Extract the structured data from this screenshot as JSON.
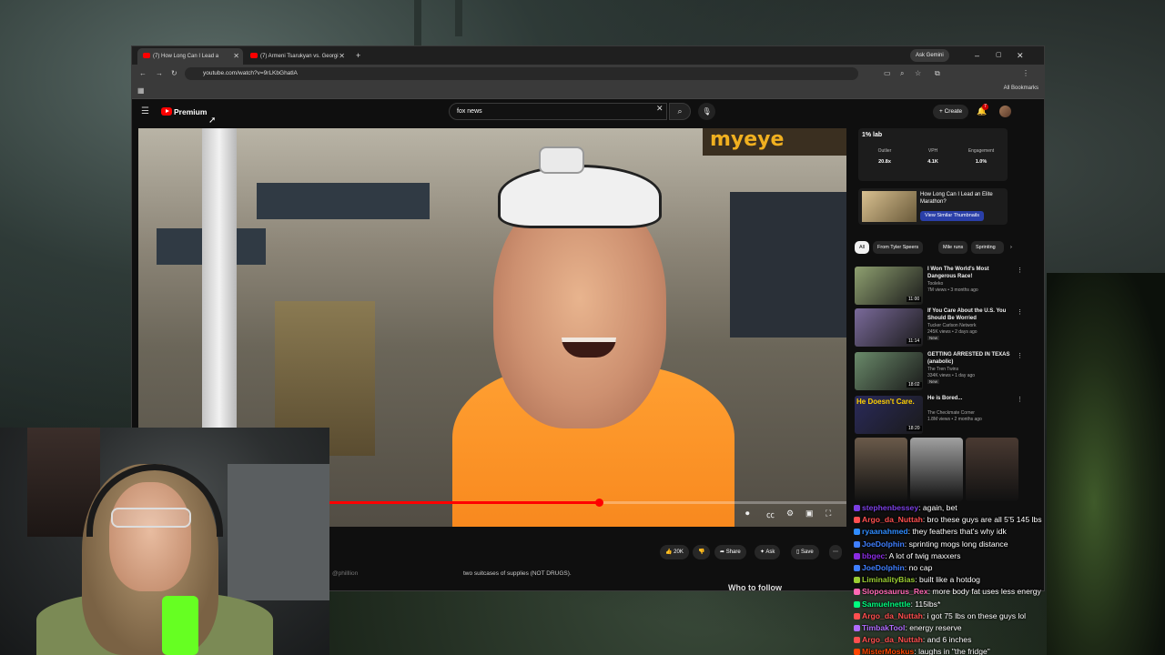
{
  "browser": {
    "tabs": [
      {
        "label": "(7) How Long Can I Lead a"
      },
      {
        "label": "(7) Armeni Tsarukyan vs. Georgi"
      }
    ],
    "gemini_label": "Ask Gemini",
    "url": "youtube.com/watch?v=9rLKbGhatlA",
    "all_bookmarks": "All Bookmarks"
  },
  "youtube": {
    "logo_label": "Premium",
    "search_value": "fox news",
    "create_label": "Create",
    "notif_count": "7",
    "actions": {
      "like": "20K",
      "share": "Share",
      "ask": "Ask",
      "save": "Save"
    },
    "description": "two suitcases of supplies (NOT DRUGS).",
    "handle": "@philllion",
    "who_to_follow": "Who to follow",
    "player": {
      "progress": 0.65,
      "sign": "myeye"
    },
    "extension": {
      "logo": "1% lab",
      "stats": [
        {
          "label": "Outlier",
          "value": "20.8x"
        },
        {
          "label": "VPH",
          "value": "4.1K"
        },
        {
          "label": "Engagement",
          "value": "1.0%"
        }
      ],
      "rec_title": "How Long Can I Lead an Elite Marathon?",
      "rec_button": "View Similar Thumbnails"
    },
    "chips": [
      "All",
      "From Tyler Speers",
      "Mile runs",
      "Sprinting"
    ],
    "videos": [
      {
        "title": "I Won The World's Most Dangerous Race!",
        "channel": "Tooleko",
        "meta": "7M views • 3 months ago",
        "duration": "11:00",
        "new": "",
        "color": "#8fa070"
      },
      {
        "title": "If You Care About the U.S. You Should Be Worried",
        "channel": "Tucker Carlson Network",
        "meta": "245K views • 2 days ago",
        "duration": "11:14",
        "new": "New",
        "color": "#7a6a9a"
      },
      {
        "title": "GETTING ARRESTED IN TEXAS (anabolic)",
        "channel": "The Tren Twins",
        "meta": "334K views • 1 day ago",
        "duration": "18:02",
        "new": "New",
        "color": "#6a8a6a"
      },
      {
        "title": "He is Bored...",
        "channel": "The Checkmate Corner",
        "meta": "1.8M views • 2 months ago",
        "duration": "18:20",
        "new": "",
        "color": "#2a2a5a"
      }
    ],
    "shorts_thumb_text": [
      "He Doesn't Care."
    ],
    "shorts_colors": [
      "#6a5a4a",
      "#a0a0a0",
      "#4a3a32"
    ]
  },
  "chat": [
    {
      "user": "stephenbessey",
      "text": "again, bet",
      "color": "#7b3fe4"
    },
    {
      "user": "Argo_da_Nuttah",
      "text": "bro these guys are all 5'5 145 lbs",
      "color": "#ff4f4f"
    },
    {
      "user": "ryaanahmed",
      "text": "they feathers that's why idk",
      "color": "#2f8cff"
    },
    {
      "user": "JoeDolphin",
      "text": "sprinting mogs long distance",
      "color": "#3f7fff"
    },
    {
      "user": "bbgec",
      "text": "A lot of twig maxxers",
      "color": "#8a2be2"
    },
    {
      "user": "JoeDolphin",
      "text": "no cap",
      "color": "#3f7fff"
    },
    {
      "user": "LiminalityBias",
      "text": "built like a hotdog",
      "color": "#9acd32"
    },
    {
      "user": "Sloposaurus_Rex",
      "text": "more body fat uses less energy",
      "color": "#ff69b4"
    },
    {
      "user": "Samuelnettle",
      "text": "115lbs*",
      "color": "#00ff7f"
    },
    {
      "user": "Argo_da_Nuttah",
      "text": "i got 75 lbs on these guys lol",
      "color": "#ff4f4f"
    },
    {
      "user": "TimbakTool",
      "text": "energy reserve",
      "color": "#b06cff"
    },
    {
      "user": "Argo_da_Nuttah",
      "text": "and 6 inches",
      "color": "#ff4f4f"
    },
    {
      "user": "MisterMoskus",
      "text": "laughs in \"the fridge\"",
      "color": "#ff4500"
    }
  ]
}
